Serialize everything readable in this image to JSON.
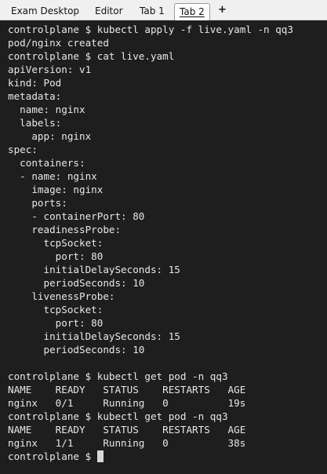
{
  "tabs": [
    {
      "label": "Exam Desktop",
      "active": false
    },
    {
      "label": "Editor",
      "active": false
    },
    {
      "label": "Tab 1",
      "active": false
    },
    {
      "label": "Tab 2",
      "active": true
    }
  ],
  "new_tab_label": "+",
  "terminal": {
    "lines": [
      "controlplane $ kubectl apply -f live.yaml -n qq3",
      "pod/nginx created",
      "controlplane $ cat live.yaml",
      "apiVersion: v1",
      "kind: Pod",
      "metadata:",
      "  name: nginx",
      "  labels:",
      "    app: nginx",
      "spec:",
      "  containers:",
      "  - name: nginx",
      "    image: nginx",
      "    ports:",
      "    - containerPort: 80",
      "    readinessProbe:",
      "      tcpSocket:",
      "        port: 80",
      "      initialDelaySeconds: 15",
      "      periodSeconds: 10",
      "    livenessProbe:",
      "      tcpSocket:",
      "        port: 80",
      "      initialDelaySeconds: 15",
      "      periodSeconds: 10",
      "",
      "controlplane $ kubectl get pod -n qq3",
      "NAME    READY   STATUS    RESTARTS   AGE",
      "nginx   0/1     Running   0          19s",
      "controlplane $ kubectl get pod -n qq3",
      "NAME    READY   STATUS    RESTARTS   AGE",
      "nginx   1/1     Running   0          38s"
    ],
    "prompt": "controlplane $ "
  }
}
